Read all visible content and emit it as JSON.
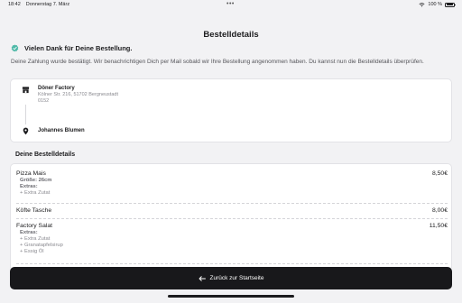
{
  "status_bar": {
    "time": "18:42",
    "date": "Donnerstag 7. März",
    "dots": "•••",
    "battery": "100 %",
    "icons": [
      "wifi-icon",
      "battery-icon"
    ]
  },
  "header": {
    "title": "Bestelldetails"
  },
  "confirmation": {
    "icon": "check-shield-icon",
    "title": "Vielen Dank für Deine Bestellung.",
    "message": "Deine Zahlung wurde bestätigt. Wir benachrichtigen Dich per Mail sobald wir Ihre Bestellung angenommen haben. Du kannst nun die Bestelldetails überprüfen."
  },
  "addresses": {
    "restaurant": {
      "icon": "store-icon",
      "name": "Döner Factory",
      "street": "Kölner Str. 216, 51702 Bergneustadt",
      "extra": "0152"
    },
    "customer": {
      "icon": "location-pin-icon",
      "name": "Johannes Blumen"
    }
  },
  "order": {
    "section_title": "Deine Bestelldetails",
    "items": [
      {
        "name": "Pizza Mais",
        "price": "8,50€",
        "lines": [
          {
            "text": "Größe: 26cm",
            "bold": true
          },
          {
            "text": "Extras:",
            "bold": true
          },
          {
            "text": "+ Extra Zutat",
            "bold": false
          }
        ]
      },
      {
        "name": "Köfte Tasche",
        "price": "8,00€",
        "lines": []
      },
      {
        "name": "Factory Salat",
        "price": "11,50€",
        "lines": [
          {
            "text": "Extras:",
            "bold": true
          },
          {
            "text": "+ Extra Zutat",
            "bold": false
          },
          {
            "text": "+ Granatapfelsirup",
            "bold": false
          },
          {
            "text": "+ Essig Öl",
            "bold": false
          }
        ]
      }
    ]
  },
  "footer": {
    "back_label": "Zurück zur Startseite",
    "back_icon": "arrow-left-icon"
  },
  "colors": {
    "background": "#f2f2f4",
    "accent_check": "#4fb9a8",
    "button": "#18181b"
  }
}
